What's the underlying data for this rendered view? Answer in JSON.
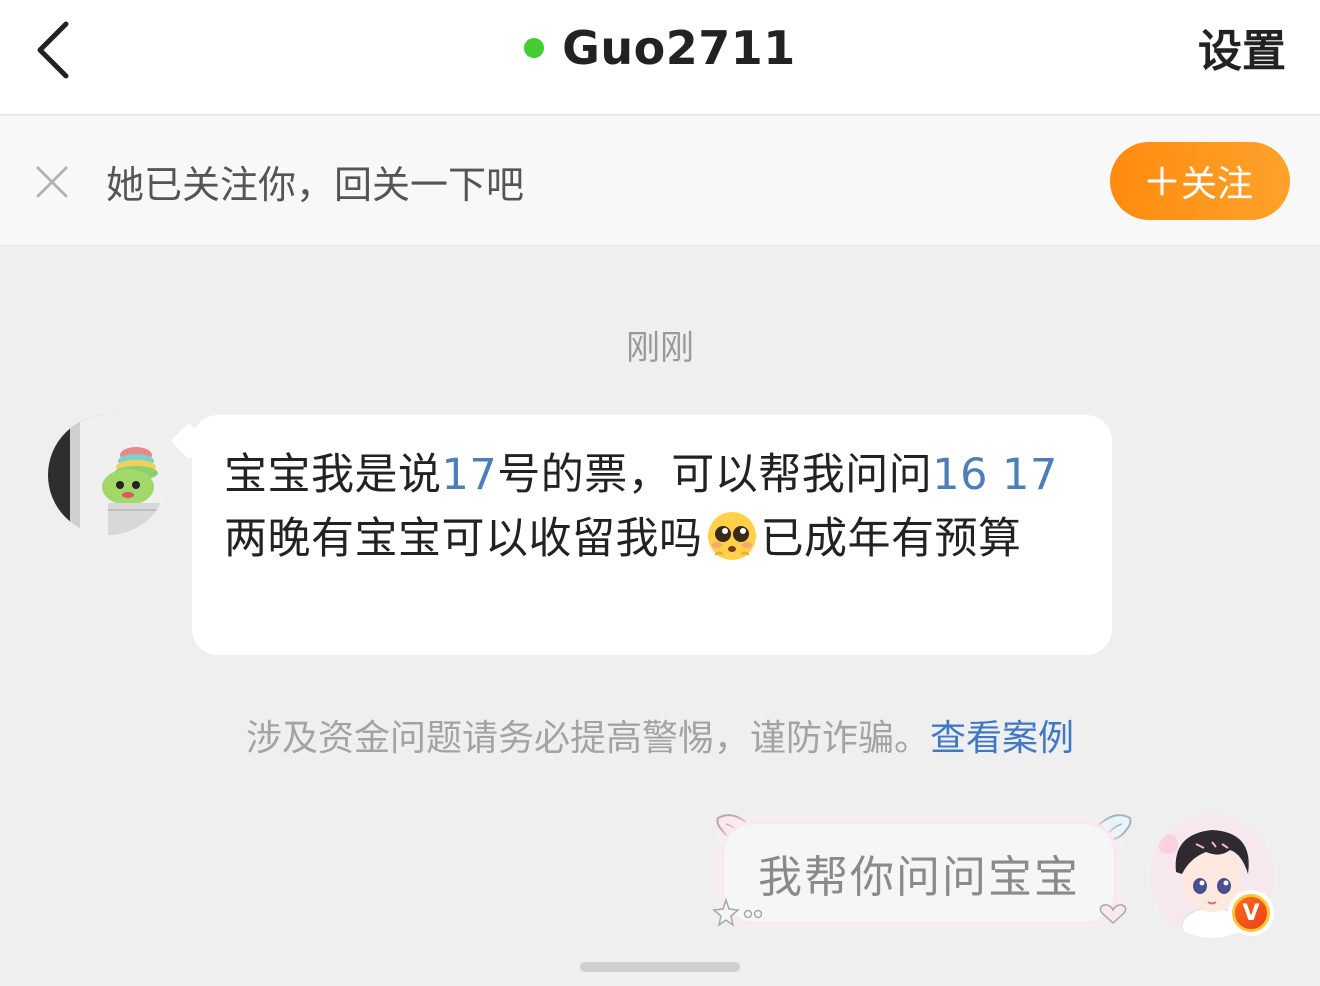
{
  "header": {
    "title": "Guo2711",
    "settings_label": "设置",
    "online_color": "#44cc33"
  },
  "follow_banner": {
    "text": "她已关注你，回关一下吧",
    "button_label": "关注",
    "button_color": "#ff9520"
  },
  "chat": {
    "timestamp": "刚刚",
    "incoming": {
      "part1": "宝宝我是说",
      "num1": "17",
      "part2": "号的票，可以帮我问问",
      "num2": "16 17",
      "part3": "两晚有宝宝可以收留我吗",
      "emoji": "pleading-face-emoji",
      "part4": "已成年有预算"
    },
    "warning": {
      "text": "涉及资金问题请务必提高警惕，谨防诈骗。",
      "link_label": "查看案例",
      "link_color": "#3f78c3"
    },
    "outgoing": {
      "text": "我帮你问问宝宝"
    }
  },
  "badges": {
    "verified_letter": "V"
  }
}
